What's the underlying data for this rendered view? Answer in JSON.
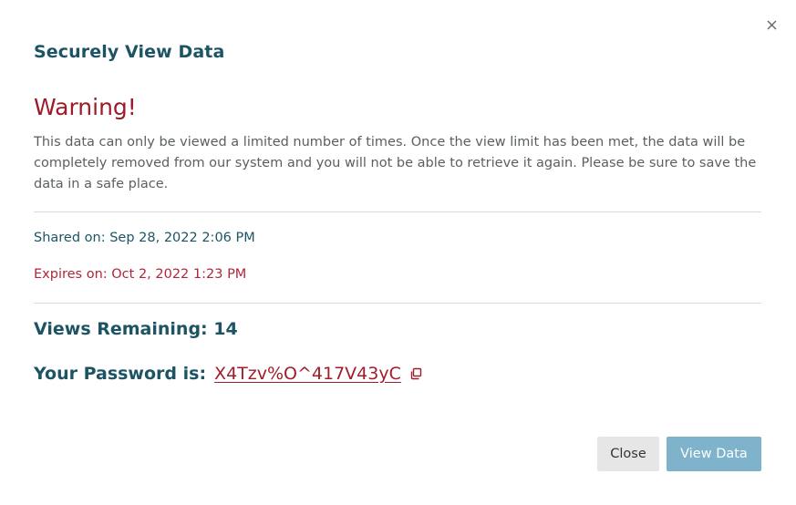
{
  "modal": {
    "title": "Securely View Data",
    "warning_heading": "Warning!",
    "warning_text": "This data can only be viewed a limited number of times. Once the view limit has been met, the data will be completely removed from our system and you will not be able to retrieve it again. Please be sure to save the data in a safe place.",
    "shared_label": "Shared on: Sep 28, 2022 2:06 PM",
    "expires_label": "Expires on: Oct 2, 2022 1:23 PM",
    "views_remaining": "Views Remaining: 14",
    "password_label": "Your Password is:",
    "password_value": "X4Tzv%O^417V43yC",
    "close_button": "Close",
    "view_button": "View Data"
  },
  "icons": {
    "close": "close-icon",
    "copy": "copy-icon"
  },
  "colors": {
    "title": "#1c5464",
    "warning": "#9e1b2a",
    "expires": "#b0263a",
    "primary_button": "#7fb3cc",
    "secondary_button": "#e6e6e6"
  }
}
